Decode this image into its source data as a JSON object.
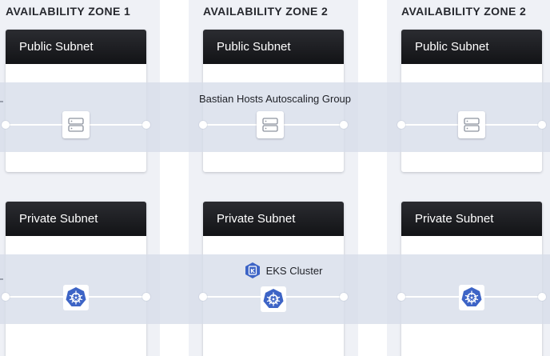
{
  "zones": [
    {
      "title": "AVAILABILITY ZONE 1"
    },
    {
      "title": "AVAILABILITY ZONE 2"
    },
    {
      "title": "AVAILABILITY ZONE 2"
    }
  ],
  "public_subnet_label": "Public Subnet",
  "private_subnet_label": "Private Subnet",
  "bastian_group_label": "Bastian Hosts Autoscaling Group",
  "eks_cluster_label": "EKS Cluster",
  "colors": {
    "zone_background": "#eff1f6",
    "subnet_header": "#17181c",
    "band": "#d6dce9",
    "kubernetes_blue": "#3d64c6"
  }
}
